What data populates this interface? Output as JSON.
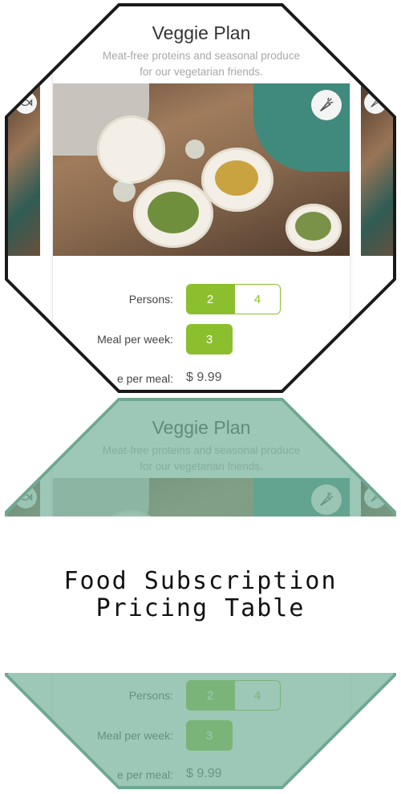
{
  "plan": {
    "title": "Veggie Plan",
    "subtitle_line1": "Meat-free proteins and seasonal produce",
    "subtitle_line2": "for our vegetarian friends.",
    "icon": "carrot-icon",
    "side_icon": "fish-icon"
  },
  "options": {
    "persons_label": "Persons:",
    "persons_values": [
      "2",
      "4"
    ],
    "persons_selected": "2",
    "meals_label": "Meal per week:",
    "meals_values": [
      "3"
    ],
    "price_label": "e per meal:",
    "price_value": "$ 9.99"
  },
  "banner": {
    "title_line1": "Food Subscription",
    "title_line2": "Pricing Table"
  },
  "colors": {
    "accent": "#8cbf2e",
    "tint": "#73af98",
    "frame": "#1a1a1a"
  }
}
